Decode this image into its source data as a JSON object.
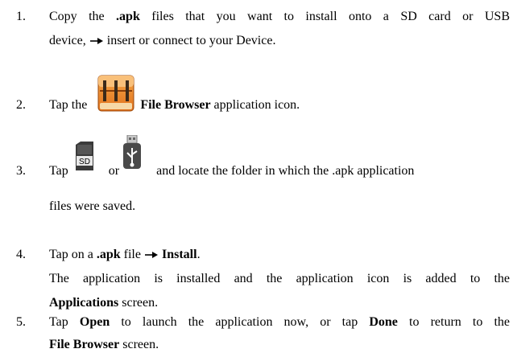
{
  "steps": [
    {
      "num": "1.",
      "line1_a": "Copy the ",
      "line1_b": ".apk",
      "line1_c": " files that you want to install onto a SD card or USB",
      "line2_a": "device,",
      "line2_b": "insert or connect to your Device."
    },
    {
      "num": "2.",
      "a": "Tap the",
      "b": "File Browser",
      "c": " application icon."
    },
    {
      "num": "3.",
      "a": "Tap",
      "b": "or",
      "c": "and locate the folder in which the .apk application",
      "line2": "files were saved.",
      "sd_label": "SD"
    },
    {
      "num": "4.",
      "a": "Tap on a ",
      "b": ".apk",
      "c": " file",
      "d": "Install",
      "e": ".",
      "p2_a": "The application is installed and the application icon is added to the",
      "p2_b": "Applications",
      "p2_c": " screen."
    },
    {
      "num": "5.",
      "a": "Tap ",
      "b": "Open",
      "c": " to launch the application now, or tap ",
      "d": "Done",
      "e": " to return to the",
      "f": "File Browser",
      "g": " screen."
    }
  ]
}
